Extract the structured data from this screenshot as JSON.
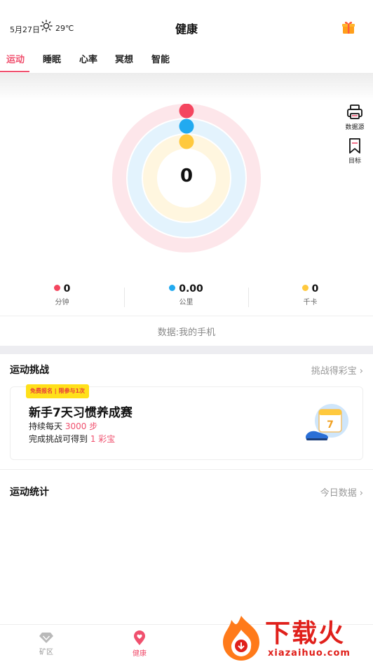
{
  "status": {
    "date": "5月27日",
    "weather_icon": "sun-icon",
    "temperature": "29℃",
    "gift_icon": "gift-icon"
  },
  "header": {
    "title": "健康"
  },
  "tabs": [
    {
      "label": "运动",
      "active": true
    },
    {
      "label": "睡眠",
      "active": false
    },
    {
      "label": "心率",
      "active": false
    },
    {
      "label": "冥想",
      "active": false
    },
    {
      "label": "智能",
      "active": false
    }
  ],
  "rings": {
    "center_value": "0",
    "colors": {
      "minutes": "#f4465f",
      "distance": "#22aaf0",
      "calories": "#ffc93e"
    }
  },
  "side_tools": {
    "data_source_label": "数据源",
    "goal_label": "目标"
  },
  "metrics": [
    {
      "value": "0",
      "unit": "分钟",
      "color": "#f4465f"
    },
    {
      "value": "0.00",
      "unit": "公里",
      "color": "#22aaf0"
    },
    {
      "value": "0",
      "unit": "千卡",
      "color": "#ffc93e"
    }
  ],
  "data_source_text": "数据:我的手机",
  "challenge": {
    "title": "运动挑战",
    "link": "挑战得彩宝",
    "card": {
      "badge": "免费报名 | 限参与1次",
      "title": "新手7天习惯养成赛",
      "line1_prefix": "持续每天 ",
      "line1_highlight": "3000 步",
      "line2_prefix": "完成挑战可得到 ",
      "line2_highlight": "1 彩宝"
    }
  },
  "stats": {
    "title": "运动统计",
    "link": "今日数据"
  },
  "bottom_nav": [
    {
      "label": "矿区",
      "icon": "gem-icon",
      "active": false
    },
    {
      "label": "健康",
      "icon": "heart-pin-icon",
      "active": true
    }
  ],
  "watermark": {
    "text": "下载火",
    "sub": "xiazaihuo.com"
  },
  "accent_color": "#f0506e"
}
